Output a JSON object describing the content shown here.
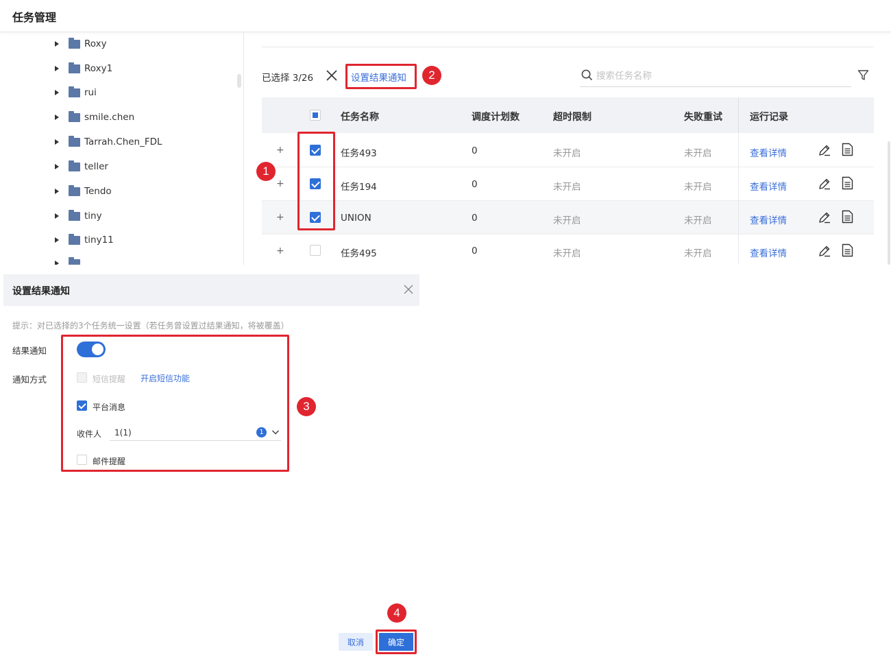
{
  "page": {
    "title": "任务管理"
  },
  "tree": {
    "items": [
      "Roxy",
      "Roxy1",
      "rui",
      "smile.chen",
      "Tarrah.Chen_FDL",
      "teller",
      "Tendo",
      "tiny",
      "tiny11",
      "..."
    ]
  },
  "toolbar": {
    "selected_label": "已选择 3/26",
    "set_notify_label": "设置结果通知",
    "search_placeholder": "搜索任务名称"
  },
  "table": {
    "columns": [
      "任务名称",
      "调度计划数",
      "超时限制",
      "失败重试",
      "运行记录"
    ],
    "rows": [
      {
        "name": "任务493",
        "schedules": "0",
        "timeout": "未开启",
        "retry": "未开启",
        "record": "查看详情",
        "checked": true
      },
      {
        "name": "任务194",
        "schedules": "0",
        "timeout": "未开启",
        "retry": "未开启",
        "record": "查看详情",
        "checked": true
      },
      {
        "name": "UNION",
        "schedules": "0",
        "timeout": "未开启",
        "retry": "未开启",
        "record": "查看详情",
        "checked": true
      },
      {
        "name": "任务495",
        "schedules": "0",
        "timeout": "未开启",
        "retry": "未开启",
        "record": "查看详情",
        "checked": false
      }
    ]
  },
  "dialog": {
    "title": "设置结果通知",
    "hint": "提示：对已选择的3个任务统一设置（若任务曾设置过结果通知，将被覆盖）",
    "notify_label": "结果通知",
    "method_label": "通知方式",
    "sms_label": "短信提醒",
    "enable_sms_link": "开启短信功能",
    "platform_label": "平台消息",
    "recipient_label": "收件人",
    "recipient_value": "1(1)",
    "recipient_count": "1",
    "email_label": "邮件提醒",
    "cancel_label": "取消",
    "ok_label": "确定"
  },
  "annotations": {
    "markers": [
      "1",
      "2",
      "3",
      "4"
    ]
  },
  "colors": {
    "accent": "#2e6fd8",
    "annotation": "#e0252f"
  }
}
